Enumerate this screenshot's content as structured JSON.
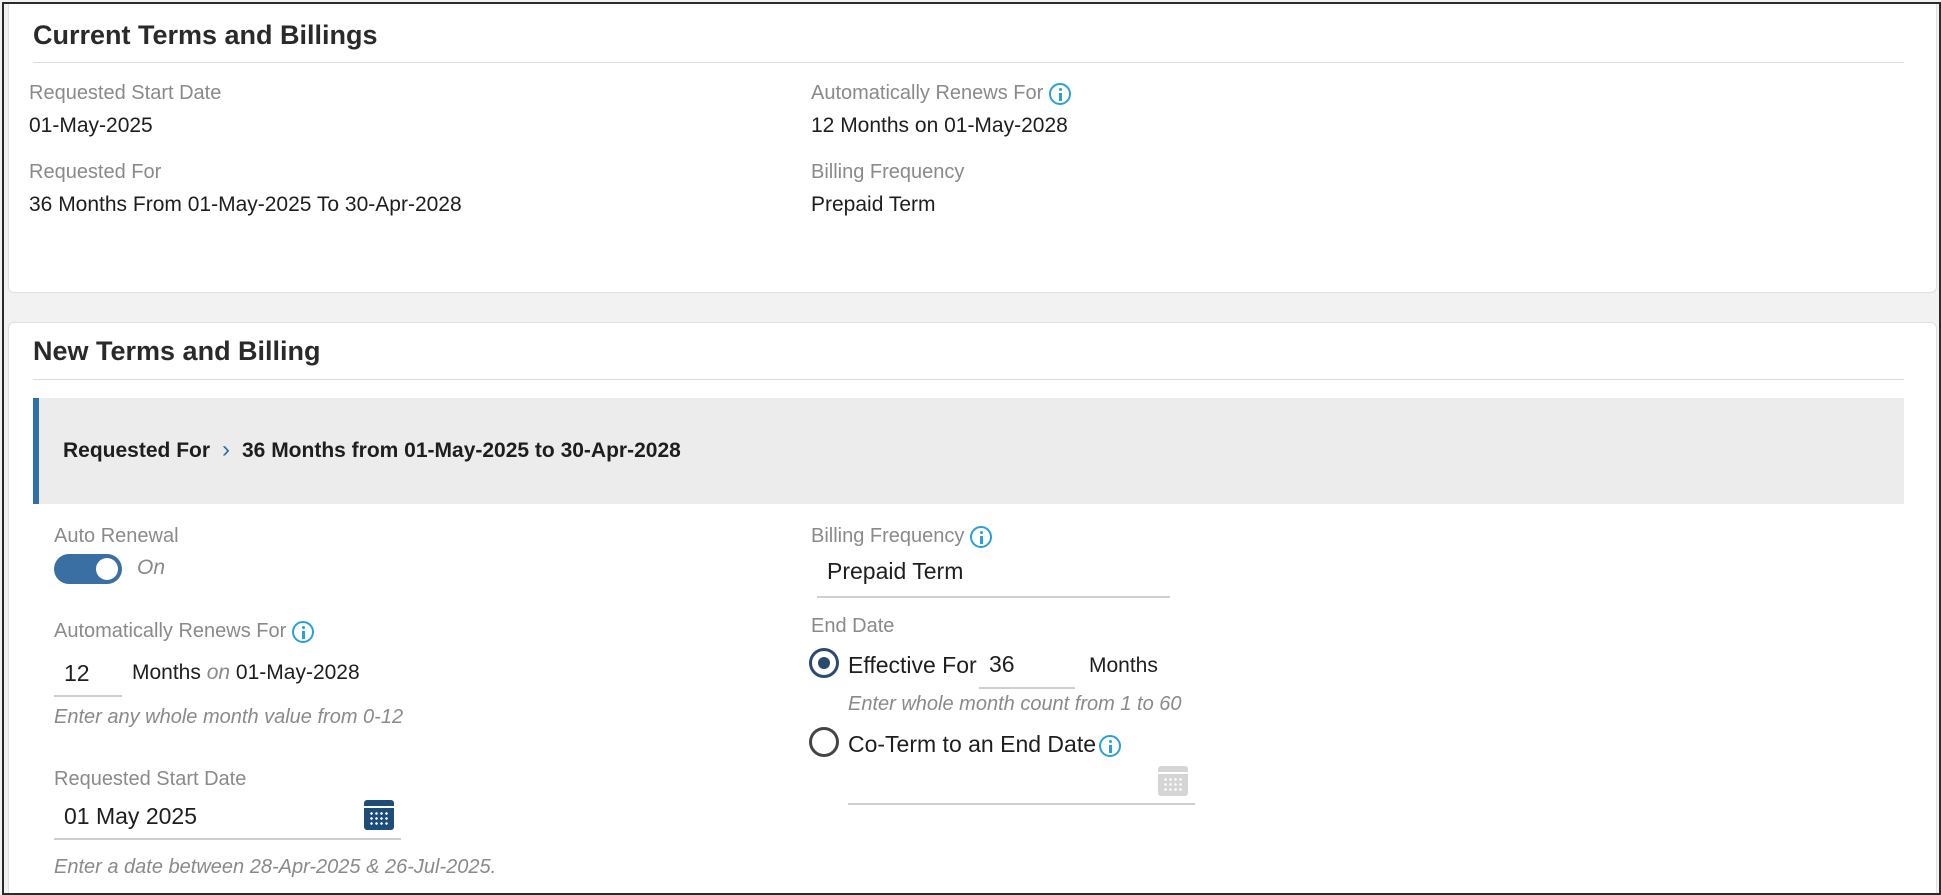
{
  "current": {
    "title": "Current Terms and Billings",
    "requested_start_date_label": "Requested Start Date",
    "requested_start_date_value": "01-May-2025",
    "auto_renews_label": "Automatically Renews For",
    "auto_renews_value": "12 Months on 01-May-2028",
    "requested_for_label": "Requested For",
    "requested_for_value": "36 Months From 01-May-2025 To 30-Apr-2028",
    "billing_frequency_label": "Billing Frequency",
    "billing_frequency_value": "Prepaid Term"
  },
  "new_terms": {
    "title": "New Terms and Billing",
    "banner_label": "Requested For",
    "banner_value": "36 Months from 01-May-2025 to 30-Apr-2028",
    "auto_renewal_label": "Auto Renewal",
    "auto_renewal_state": "On",
    "auto_renews_label": "Automatically Renews For",
    "auto_renews_months": "12",
    "auto_renews_months_word": "Months",
    "auto_renews_on_word": "on",
    "auto_renews_date": "01-May-2028",
    "auto_renews_hint": "Enter any whole month value from 0-12",
    "start_date_label": "Requested Start Date",
    "start_date_value": "01 May 2025",
    "start_date_hint": "Enter a date between 28-Apr-2025 & 26-Jul-2025.",
    "billing_frequency_label": "Billing Frequency",
    "billing_frequency_value": "Prepaid Term",
    "end_date_label": "End Date",
    "effective_for_label": "Effective For",
    "effective_for_value": "36",
    "effective_for_unit": "Months",
    "effective_for_hint": "Enter whole month count from 1 to 60",
    "coterm_label": "Co-Term to an End Date"
  },
  "colors": {
    "accent": "#2f6ea6",
    "info_icon": "#2a9fd8",
    "calendar_icon": "#1f4d7a"
  },
  "icons": [
    "info-icon",
    "chevron-right-icon",
    "calendar-icon"
  ]
}
